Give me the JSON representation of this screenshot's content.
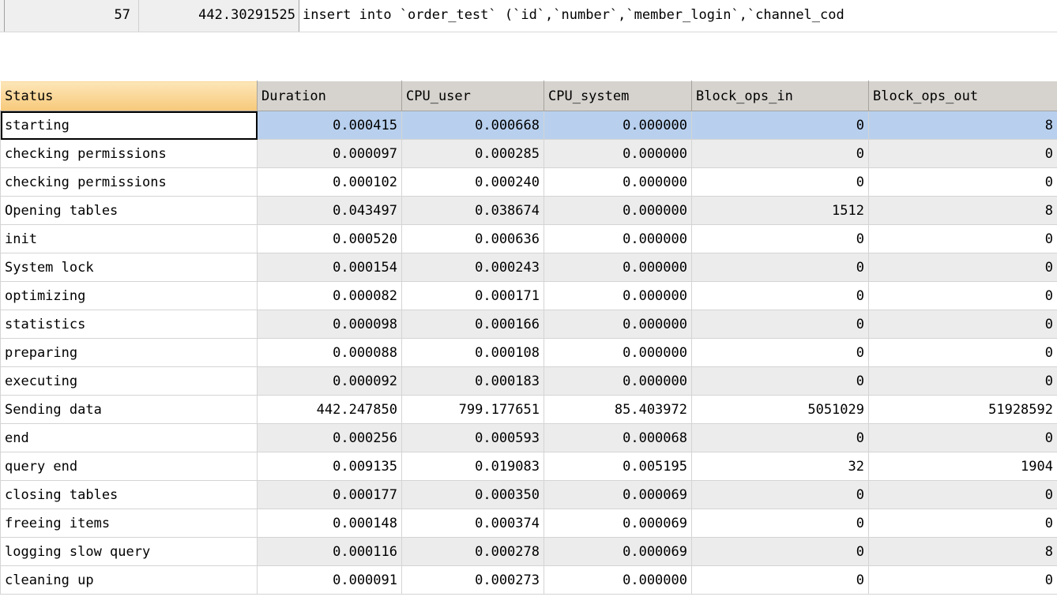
{
  "query_row": {
    "query_id": "57",
    "duration": "442.30291525",
    "query": "insert into `order_test` (`id`,`number`,`member_login`,`channel_cod"
  },
  "profile": {
    "columns": [
      "Status",
      "Duration",
      "CPU_user",
      "CPU_system",
      "Block_ops_in",
      "Block_ops_out"
    ],
    "rows": [
      [
        "starting",
        "0.000415",
        "0.000668",
        "0.000000",
        "0",
        "8"
      ],
      [
        "checking permissions",
        "0.000097",
        "0.000285",
        "0.000000",
        "0",
        "0"
      ],
      [
        "checking permissions",
        "0.000102",
        "0.000240",
        "0.000000",
        "0",
        "0"
      ],
      [
        "Opening tables",
        "0.043497",
        "0.038674",
        "0.000000",
        "1512",
        "8"
      ],
      [
        "init",
        "0.000520",
        "0.000636",
        "0.000000",
        "0",
        "0"
      ],
      [
        "System lock",
        "0.000154",
        "0.000243",
        "0.000000",
        "0",
        "0"
      ],
      [
        "optimizing",
        "0.000082",
        "0.000171",
        "0.000000",
        "0",
        "0"
      ],
      [
        "statistics",
        "0.000098",
        "0.000166",
        "0.000000",
        "0",
        "0"
      ],
      [
        "preparing",
        "0.000088",
        "0.000108",
        "0.000000",
        "0",
        "0"
      ],
      [
        "executing",
        "0.000092",
        "0.000183",
        "0.000000",
        "0",
        "0"
      ],
      [
        "Sending data",
        "442.247850",
        "799.177651",
        "85.403972",
        "5051029",
        "51928592"
      ],
      [
        "end",
        "0.000256",
        "0.000593",
        "0.000068",
        "0",
        "0"
      ],
      [
        "query end",
        "0.009135",
        "0.019083",
        "0.005195",
        "32",
        "1904"
      ],
      [
        "closing tables",
        "0.000177",
        "0.000350",
        "0.000069",
        "0",
        "0"
      ],
      [
        "freeing items",
        "0.000148",
        "0.000374",
        "0.000069",
        "0",
        "0"
      ],
      [
        "logging slow query",
        "0.000116",
        "0.000278",
        "0.000069",
        "0",
        "8"
      ],
      [
        "cleaning up",
        "0.000091",
        "0.000273",
        "0.000000",
        "0",
        "0"
      ]
    ]
  }
}
